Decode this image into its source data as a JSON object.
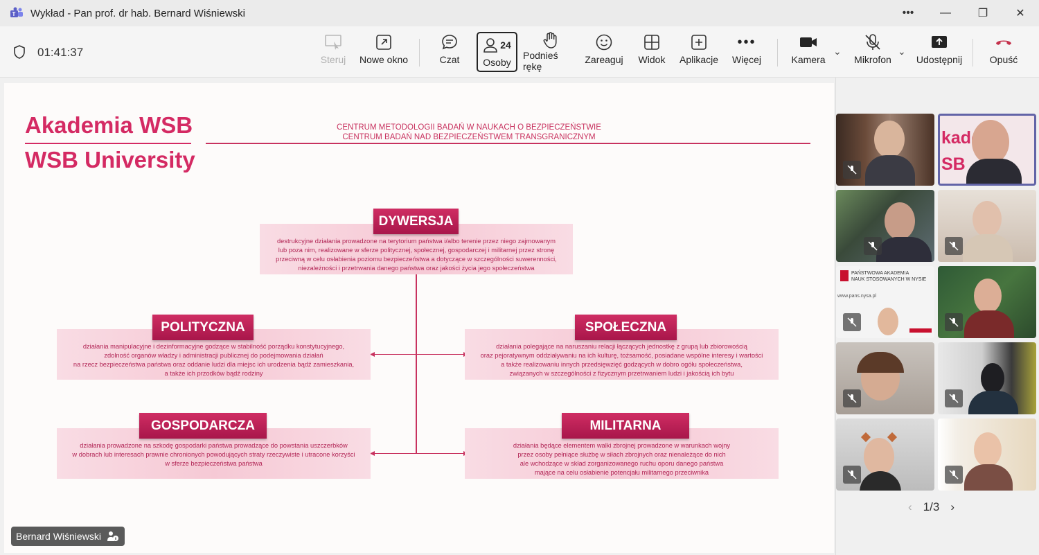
{
  "window": {
    "title": "Wykład - Pan prof. dr hab. Bernard Wiśniewski"
  },
  "toolbar": {
    "timer": "01:41:37",
    "buttons": {
      "steruj": "Steruj",
      "nowe_okno": "Nowe okno",
      "czat": "Czat",
      "osoby": "Osoby",
      "osoby_count": "24",
      "podnies_reke": "Podnieś rękę",
      "zareaguj": "Zareaguj",
      "widok": "Widok",
      "aplikacje": "Aplikacje",
      "wiecej": "Więcej",
      "kamera": "Kamera",
      "mikrofon": "Mikrofon",
      "udostepnij": "Udostępnij",
      "opusc": "Opuść"
    }
  },
  "slide": {
    "brand_pl": "Akademia WSB",
    "brand_en": "WSB University",
    "center_line1": "CENTRUM METODOLOGII BADAŃ W NAUKACH O BEZPIECZEŃSTWIE",
    "center_line2": "CENTRUM BADAŃ NAD BEZPIECZEŃSTWEM TRANSGRANICZNYM",
    "dywersja": {
      "title": "DYWERSJA",
      "lines": [
        "destrukcyjne działania prowadzone na terytorium państwa i/albo terenie przez niego zajmowanym",
        "lub poza nim, realizowane w sferze politycznej, społecznej, gospodarczej i militarnej przez stronę",
        "przeciwną w celu osłabienia poziomu bezpieczeństwa a dotyczące w szczególności suwerenności,",
        "niezależności i przetrwania danego państwa oraz jakości życia jego społeczeństwa"
      ]
    },
    "polityczna": {
      "title": "POLITYCZNA",
      "lines": [
        "działania manipulacyjne i dezinformacyjne godzące w stabilność porządku konstytucyjnego,",
        "zdolność organów władzy i administracji publicznej do podejmowania działań",
        "na rzecz bezpieczeństwa państwa oraz oddanie ludzi dla miejsc ich urodzenia bądź zamieszkania,",
        "a także ich przodków bądź rodziny"
      ]
    },
    "spoleczna": {
      "title": "SPOŁECZNA",
      "lines": [
        "działania polegające na naruszaniu relacji łączących jednostkę z grupą lub zbiorowością",
        "oraz pejoratywnym oddziaływaniu na ich kulturę,  tożsamość, posiadane wspólne interesy i wartości",
        "a także realizowaniu innych przedsięwzięć godzących w dobro ogółu społeczeństwa,",
        "związanych w szczególności z fizycznym przetrwaniem ludzi i jakością ich bytu"
      ]
    },
    "gospodarcza": {
      "title": "GOSPODARCZA",
      "lines": [
        "działania prowadzone na szkodę gospodarki państwa prowadzące do powstania  uszczerbków",
        "w dobrach lub interesach prawnie chronionych powodujących straty rzeczywiste i utracone korzyści",
        "w sferze bezpieczeństwa państwa"
      ]
    },
    "militarna": {
      "title": "MILITARNA",
      "lines": [
        "działania będące elementem walki zbrojnej prowadzone w warunkach wojny",
        "przez osoby pełniące służbę w siłach zbrojnych oraz nienależące do nich",
        "ale wchodzące w skład zorganizowanego ruchu oporu danego państwa",
        "mające na celu osłabienie potencjału militarnego przeciwnika"
      ]
    }
  },
  "presenter": {
    "name": "Bernard Wiśniewski"
  },
  "gallery": {
    "page": "1/3"
  },
  "colors": {
    "accent": "#d42a63",
    "hangup": "#c4314b"
  }
}
